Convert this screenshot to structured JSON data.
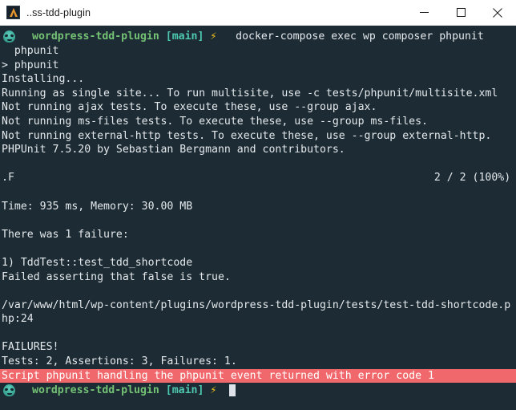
{
  "window": {
    "title": "..ss-tdd-plugin",
    "app_icon": "terminal-app-icon",
    "controls": {
      "minimize": "minimize-icon",
      "maximize": "maximize-icon",
      "close": "close-icon"
    }
  },
  "colors": {
    "terminal_background": "#1d2b34",
    "terminal_foreground": "#e4e9ec",
    "repo_green": "#74c274",
    "branch_teal": "#4ec9b0",
    "bolt_yellow": "#f5c518",
    "error_background": "#f0686c",
    "error_foreground": "#ffffff",
    "cursor": "#dde3e8",
    "titlebar_background": "#ffffff",
    "titlebar_foreground": "#1b1b1b"
  },
  "prompt_top": {
    "icon": "alien-face-icon",
    "repo": "wordpress-tdd-plugin",
    "branch": "[main]",
    "bolt": "⚡",
    "command": "docker-compose exec wp composer phpunit"
  },
  "prompt_bottom": {
    "icon": "alien-face-icon",
    "repo": "wordpress-tdd-plugin",
    "branch": "[main]",
    "bolt": "⚡",
    "command": ""
  },
  "output": {
    "lines": [
      "  phpunit",
      "> phpunit",
      "Installing...",
      "Running as single site... To run multisite, use -c tests/phpunit/multisite.xml",
      "Not running ajax tests. To execute these, use --group ajax.",
      "Not running ms-files tests. To execute these, use --group ms-files.",
      "Not running external-http tests. To execute these, use --group external-http.",
      "PHPUnit 7.5.20 by Sebastian Bergmann and contributors.",
      "",
      ".F                                                                  2 / 2 (100%)",
      "",
      "Time: 935 ms, Memory: 30.00 MB",
      "",
      "There was 1 failure:",
      "",
      "1) TddTest::test_tdd_shortcode",
      "Failed asserting that false is true.",
      "",
      "/var/www/html/wp-content/plugins/wordpress-tdd-plugin/tests/test-tdd-shortcode.p",
      "hp:24",
      "",
      "FAILURES!",
      "Tests: 2, Assertions: 3, Failures: 1."
    ],
    "error_line": "Script phpunit handling the phpunit event returned with error code 1"
  },
  "test_summary": {
    "progress": ".F",
    "progress_count": "2 / 2 (100%)",
    "time": "935 ms",
    "memory": "30.00 MB",
    "failures_header": "There was 1 failure:",
    "failure_title": "1) TddTest::test_tdd_shortcode",
    "failure_message": "Failed asserting that false is true.",
    "failure_file": "/var/www/html/wp-content/plugins/wordpress-tdd-plugin/tests/test-tdd-shortcode.php:24",
    "banner": "FAILURES!",
    "totals": "Tests: 2, Assertions: 3, Failures: 1.",
    "phpunit_version": "PHPUnit 7.5.20 by Sebastian Bergmann and contributors."
  }
}
